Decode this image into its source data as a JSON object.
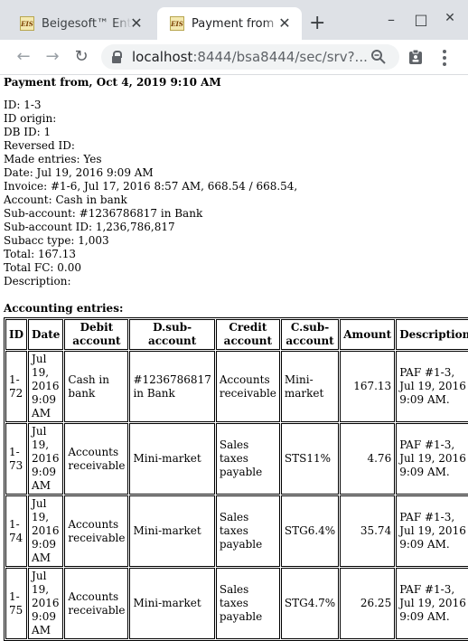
{
  "browser": {
    "tabs": [
      {
        "title": "Beigesoft™ Ent",
        "favicon": "EIS"
      },
      {
        "title": "Payment from ",
        "favicon": "EIS"
      }
    ],
    "url_host": "localhost",
    "url_rest": ":8444/bsa8444/sec/srv?...",
    "new_tab": "+",
    "window_buttons": {
      "minimize": "–",
      "maximize": "□",
      "close": "✕"
    }
  },
  "page": {
    "heading": "Payment from, Oct 4, 2019 9:10 AM",
    "fields": [
      "ID: 1-3",
      "ID origin:",
      "DB ID: 1",
      "Reversed ID:",
      "Made entries: Yes",
      "Date: Jul 19, 2016 9:09 AM",
      "Invoice: #1-6, Jul 17, 2016 8:57 AM, 668.54 / 668.54,",
      "Account: Cash in bank",
      "Sub-account: #1236786817 in Bank",
      "Sub-account ID: 1,236,786,817",
      "Subacc type: 1,003",
      "Total: 167.13",
      "Total FC: 0.00",
      "Description:"
    ],
    "entries_heading": "Accounting entries:",
    "columns": [
      "ID",
      "Date",
      "Debit account",
      "D.sub-account",
      "Credit account",
      "C.sub-account",
      "Amount",
      "Description"
    ],
    "rows": [
      [
        "1-72",
        "Jul 19, 2016 9:09 AM",
        "Cash in bank",
        "#1236786817 in Bank",
        "Accounts receivable",
        "Mini-market",
        "167.13",
        "PAF #1-3, Jul 19, 2016 9:09 AM."
      ],
      [
        "1-73",
        "Jul 19, 2016 9:09 AM",
        "Accounts receivable",
        "Mini-market",
        "Sales taxes payable",
        "STS11%",
        "4.76",
        "PAF #1-3, Jul 19, 2016 9:09 AM."
      ],
      [
        "1-74",
        "Jul 19, 2016 9:09 AM",
        "Accounts receivable",
        "Mini-market",
        "Sales taxes payable",
        "STG6.4%",
        "35.74",
        "PAF #1-3, Jul 19, 2016 9:09 AM."
      ],
      [
        "1-75",
        "Jul 19, 2016 9:09 AM",
        "Accounts receivable",
        "Mini-market",
        "Sales taxes payable",
        "STG4.7%",
        "26.25",
        "PAF #1-3, Jul 19, 2016 9:09 AM."
      ]
    ]
  }
}
